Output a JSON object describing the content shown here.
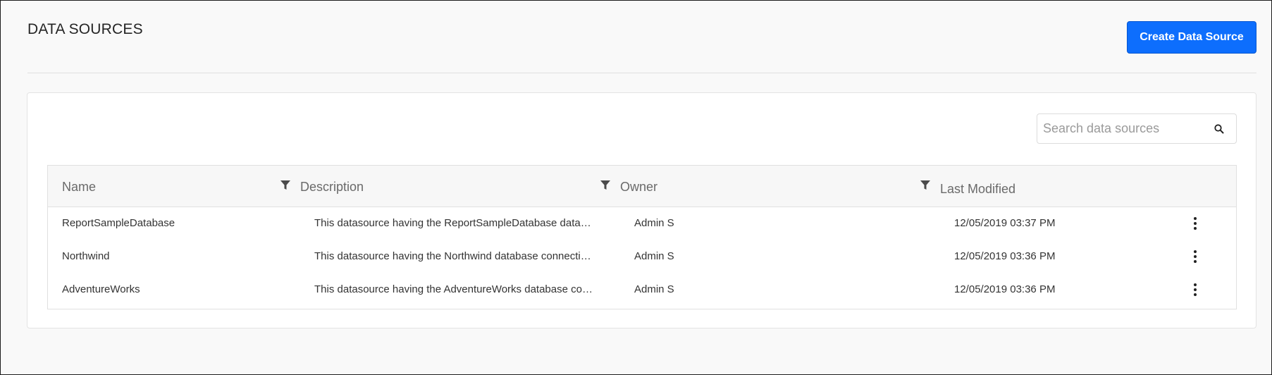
{
  "header": {
    "title": "DATA SOURCES",
    "create_button_label": "Create Data Source"
  },
  "search": {
    "placeholder": "Search data sources",
    "value": "",
    "icon": "search-icon"
  },
  "table": {
    "columns": [
      {
        "label": "Name",
        "filterable": true
      },
      {
        "label": "Description",
        "filterable": true
      },
      {
        "label": "Owner",
        "filterable": true
      },
      {
        "label": "Last Modified",
        "filterable": false
      }
    ],
    "rows": [
      {
        "name": "ReportSampleDatabase",
        "description": "This datasource having the ReportSampleDatabase data…",
        "owner": "Admin S",
        "last_modified": "12/05/2019 03:37 PM"
      },
      {
        "name": "Northwind",
        "description": "This datasource having the Northwind database connecti…",
        "owner": "Admin S",
        "last_modified": "12/05/2019 03:36 PM"
      },
      {
        "name": "AdventureWorks",
        "description": "This datasource having the AdventureWorks database co…",
        "owner": "Admin S",
        "last_modified": "12/05/2019 03:36 PM"
      }
    ]
  },
  "colors": {
    "accent": "#0d6efd",
    "header_bg": "#f7f7f7",
    "page_bg": "#f9f9f9"
  }
}
